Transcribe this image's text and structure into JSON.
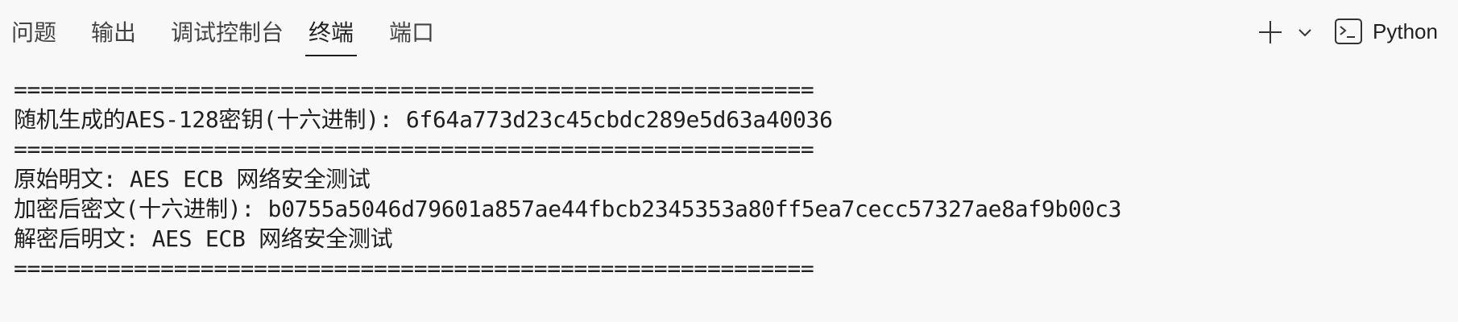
{
  "tabs": [
    {
      "label": "问题",
      "active": false
    },
    {
      "label": "输出",
      "active": false
    },
    {
      "label": "调试控制台",
      "active": false
    },
    {
      "label": "终端",
      "active": true
    },
    {
      "label": "端口",
      "active": false
    }
  ],
  "actions": {
    "new_terminal_icon": "plus-icon",
    "dropdown_icon": "chevron-down-icon",
    "profile_icon": "terminal-icon",
    "profile_label": "Python"
  },
  "terminal": {
    "lines": [
      "============================================================",
      "随机生成的AES-128密钥(十六进制): 6f64a773d23c45cbdc289e5d63a40036",
      "============================================================",
      "原始明文: AES ECB 网络安全测试",
      "加密后密文(十六进制): b0755a5046d79601a857ae44fbcb2345353a80ff5ea7cecc57327ae8af9b00c3",
      "解密后明文: AES ECB 网络安全测试",
      "============================================================"
    ]
  },
  "colors": {
    "background": "#f8f8f8",
    "text": "#1f1f1f",
    "tab_inactive": "#444444"
  }
}
